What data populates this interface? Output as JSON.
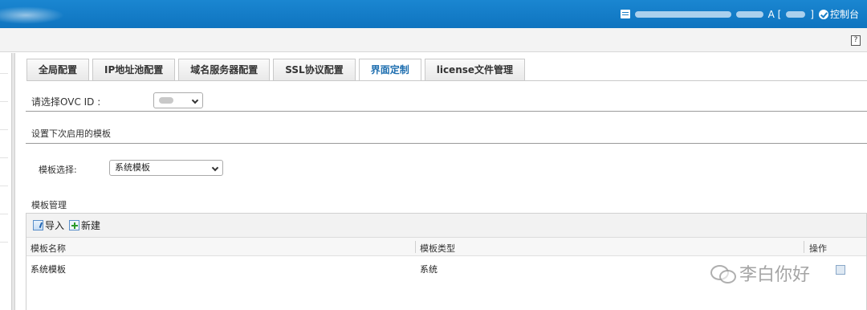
{
  "header": {
    "user_suffix": "A [",
    "user_close": "]",
    "console_label": "控制台"
  },
  "tabs": [
    {
      "label": "全局配置",
      "active": false
    },
    {
      "label": "IP地址池配置",
      "active": false
    },
    {
      "label": "域名服务器配置",
      "active": false
    },
    {
      "label": "SSL协议配置",
      "active": false
    },
    {
      "label": "界面定制",
      "active": true
    },
    {
      "label": "license文件管理",
      "active": false
    }
  ],
  "ovc": {
    "label": "请选择OVC ID :"
  },
  "next_template": {
    "section_title": "设置下次启用的模板",
    "select_label": "模板选择:",
    "selected_value": "系统模板"
  },
  "template_mgmt": {
    "section_title": "模板管理",
    "toolbar": {
      "import_label": "导入",
      "new_label": "新建"
    },
    "columns": [
      "模板名称",
      "模板类型",
      "操作"
    ],
    "rows": [
      {
        "name": "系统模板",
        "type": "系统"
      }
    ]
  },
  "watermark": {
    "text": "李白你好"
  },
  "colors": {
    "header_blue": "#1580c9",
    "active_tab_text": "#1f6fb0"
  }
}
